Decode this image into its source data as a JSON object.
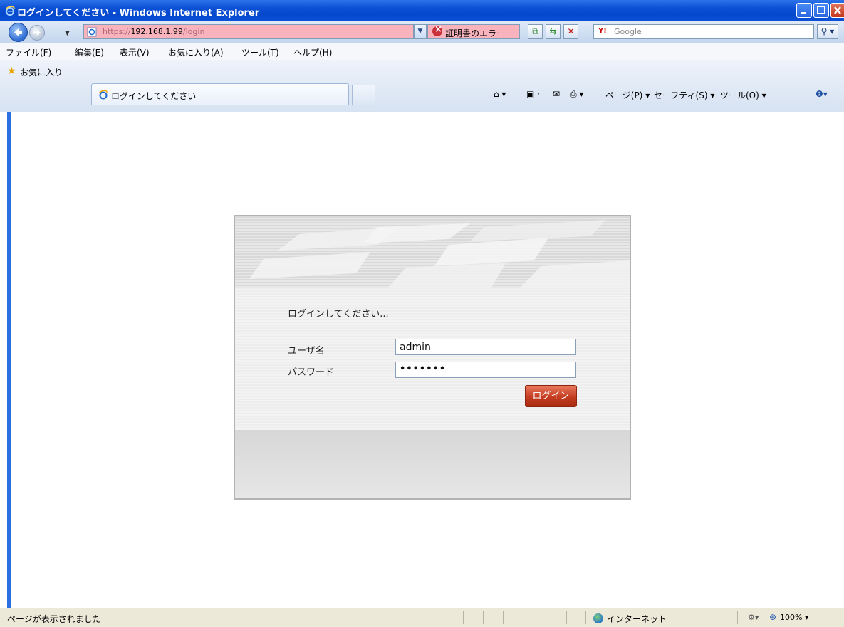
{
  "window": {
    "title": "ログインしてください - Windows Internet Explorer"
  },
  "nav": {
    "address_prefix": "https://",
    "address_host": "192.168.1.99",
    "address_path": "/login",
    "cert_error": "証明書のエラー",
    "search_placeholder": "Google",
    "search_provider_icon": "Y!"
  },
  "menu": {
    "items": [
      "ファイル(F)",
      "編集(E)",
      "表示(V)",
      "お気に入り(A)",
      "ツール(T)",
      "ヘルプ(H)"
    ]
  },
  "favbar": {
    "favorites_label": "お気に入り",
    "tab_title": "ログインしてください",
    "page_label": "ページ(P)",
    "safety_label": "セーフティ(S)",
    "tools_label": "ツール(O)"
  },
  "login": {
    "prompt": "ログインしてください...",
    "username_label": "ユーザ名",
    "username_value": "admin",
    "password_label": "パスワード",
    "password_value": "•••••••",
    "submit_label": "ログイン"
  },
  "status": {
    "message": "ページが表示されました",
    "zone": "インターネット",
    "zoom": "100%"
  },
  "colors": {
    "title_bar": "#0a4fd4",
    "address_error_bg": "#f8b3bd",
    "login_button": "#c43d20",
    "content_left_border": "#2c6fe0"
  }
}
